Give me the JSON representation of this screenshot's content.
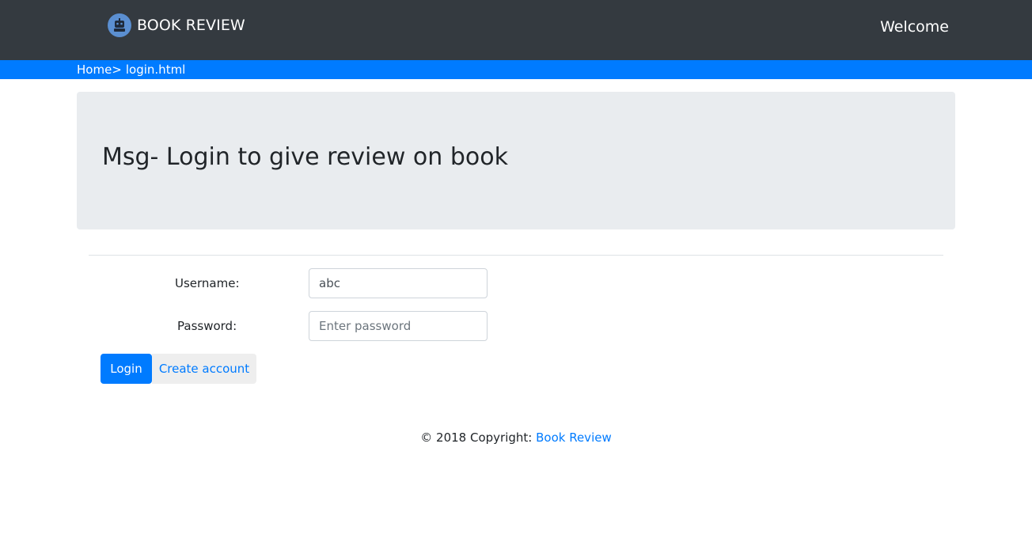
{
  "navbar": {
    "brand": "BOOK REVIEW",
    "welcome": "Welcome",
    "background": "#343a40"
  },
  "breadcrumb": {
    "home": "Home>",
    "current": "login.html",
    "background": "#007bff"
  },
  "jumbotron": {
    "message": "Msg- Login to give review on book"
  },
  "form": {
    "username_label": "Username:",
    "username_value": "abc",
    "password_label": "Password:",
    "password_placeholder": "Enter password",
    "login_label": "Login",
    "create_label": "Create account"
  },
  "footer": {
    "copyright": "© 2018 Copyright:",
    "link": "Book Review"
  },
  "colors": {
    "accent": "#007bff",
    "jumbotron_bg": "#e9ecef"
  }
}
